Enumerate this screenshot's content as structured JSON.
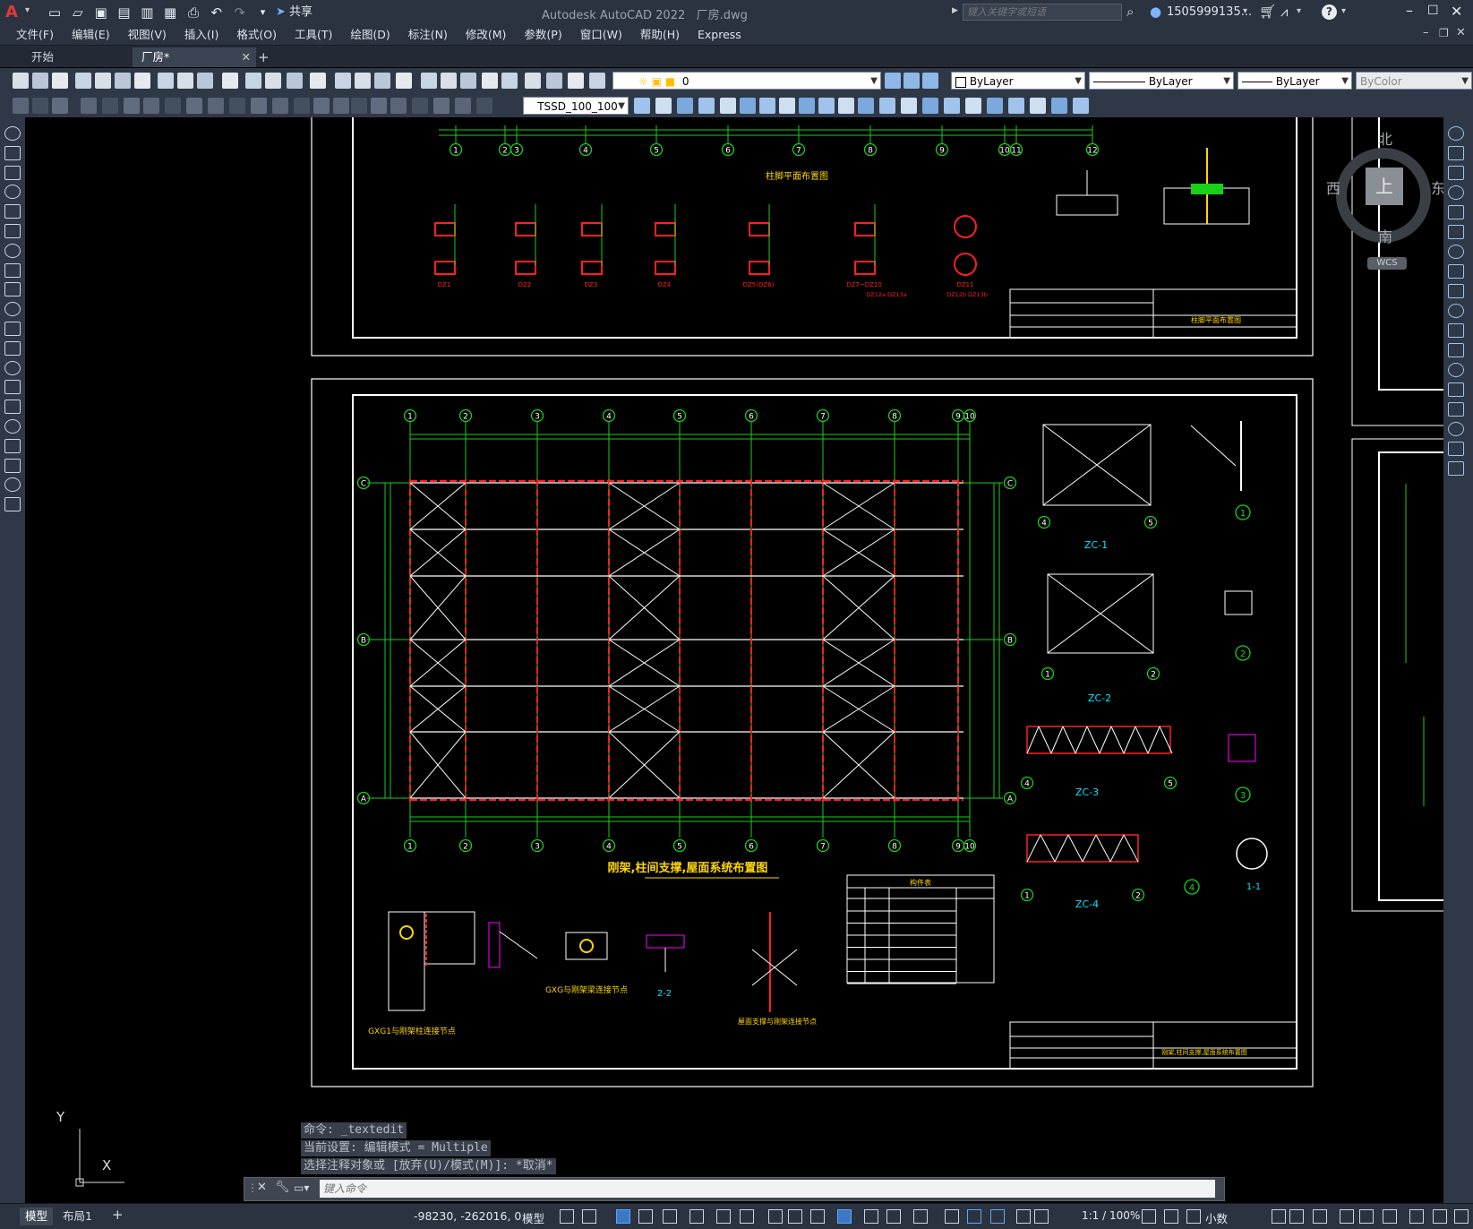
{
  "app": {
    "title": "Autodesk AutoCAD 2022",
    "filename": "厂房.dwg",
    "logo": "A",
    "share_label": "共享",
    "search_placeholder": "键入关键字或短语",
    "user": "1505999135...",
    "help": "?"
  },
  "menu": {
    "items": [
      "文件(F)",
      "编辑(E)",
      "视图(V)",
      "插入(I)",
      "格式(O)",
      "工具(T)",
      "绘图(D)",
      "标注(N)",
      "修改(M)",
      "参数(P)",
      "窗口(W)",
      "帮助(H)",
      "Express"
    ]
  },
  "doc_tabs": {
    "items": [
      {
        "label": "开始",
        "active": false
      },
      {
        "label": "厂房*",
        "active": true
      }
    ],
    "add": "+",
    "close": "✕"
  },
  "toolbar": {
    "layer_value": "0",
    "color_value": "ByLayer",
    "linetype_value": "ByLayer",
    "lineweight_value": "ByLayer",
    "plotstyle_value": "ByColor",
    "dimstyle_value": "TSSD_100_100"
  },
  "viewcube": {
    "north": "北",
    "south": "南",
    "east": "东",
    "west": "西",
    "top": "上",
    "wcs": "WCS"
  },
  "drawing": {
    "top_sheet_title": "柱脚平面布置图",
    "top_labels": [
      "DZ1",
      "DZ2",
      "DZ3",
      "DZ4",
      "DZ5(DZ6)",
      "DZ7~DZ10",
      "DZ11"
    ],
    "top_sublabels": [
      "DZ12a DZ13a",
      "DZ12b DZ13b"
    ],
    "main_title": "刚架,柱间支撑,屋面系统布置图",
    "grid_numbers": [
      "1",
      "2",
      "3",
      "4",
      "5",
      "6",
      "7",
      "8",
      "9",
      "10"
    ],
    "grid_letters": [
      "C",
      "B",
      "A"
    ],
    "top_axis_numbers": [
      "1",
      "2",
      "3",
      "4",
      "5",
      "6",
      "7",
      "8",
      "9",
      "10",
      "11",
      "12"
    ],
    "detail_labels": [
      "ZC-1",
      "ZC-2",
      "ZC-3",
      "ZC-4",
      "1-1",
      "2-2"
    ],
    "detail_circles": [
      "1",
      "2",
      "3",
      "4"
    ],
    "bottom_labels": [
      "GXG1与刚架柱连接节点",
      "GXG与刚架梁连接节点",
      "屋面支撑与刚架连接节点"
    ],
    "table_header": "构件表",
    "bottom_sheet_title": "刚架,柱间支撑,屋面系统布置图"
  },
  "command": {
    "history": [
      "命令: _textedit",
      "当前设置: 编辑模式 = Multiple",
      "选择注释对象或 [放弃(U)/模式(M)]: *取消*"
    ],
    "placeholder": "键入命令"
  },
  "ucs": {
    "x": "X",
    "y": "Y"
  },
  "status": {
    "layout_tabs": [
      "模型",
      "布局1"
    ],
    "add_layout": "+",
    "coords": "-98230, -262016, 0",
    "space": "模型",
    "scale": "1:1 / 100%",
    "units": "小数"
  }
}
